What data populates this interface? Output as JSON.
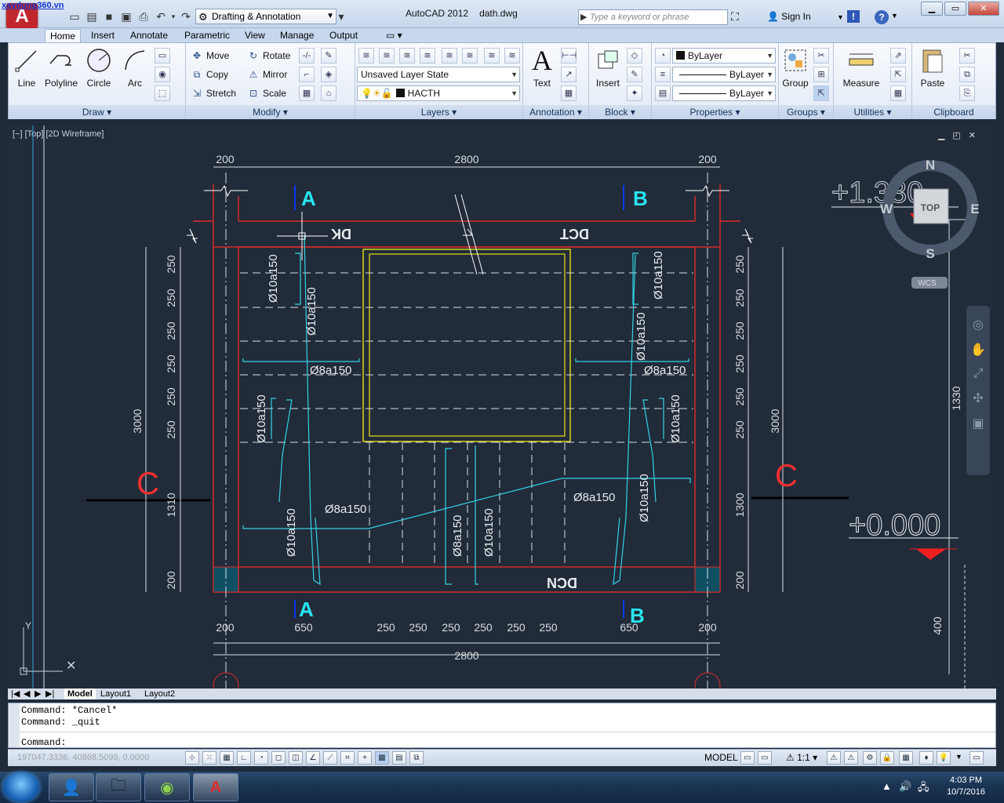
{
  "watermark": "xaydung360.vn",
  "app_logo": "A",
  "workspace": "Drafting & Annotation",
  "app_title": "AutoCAD 2012",
  "file_name": "dath.dwg",
  "search_placeholder": "Type a keyword or phrase",
  "sign_in": "Sign In",
  "tabs": [
    "Home",
    "Insert",
    "Annotate",
    "Parametric",
    "View",
    "Manage",
    "Output"
  ],
  "draw": {
    "line": "Line",
    "polyline": "Polyline",
    "circle": "Circle",
    "arc": "Arc",
    "title": "Draw"
  },
  "modify": {
    "move": "Move",
    "rotate": "Rotate",
    "copy": "Copy",
    "mirror": "Mirror",
    "stretch": "Stretch",
    "scale": "Scale",
    "title": "Modify"
  },
  "layers": {
    "state": "Unsaved Layer State",
    "current": "HACTH",
    "title": "Layers"
  },
  "annotation": {
    "text": "Text",
    "title": "Annotation"
  },
  "block": {
    "insert": "Insert",
    "title": "Block"
  },
  "properties": {
    "color": "ByLayer",
    "linetype": "ByLayer",
    "lineweight": "ByLayer",
    "title": "Properties"
  },
  "groups": {
    "group": "Group",
    "title": "Groups"
  },
  "utilities": {
    "measure": "Measure",
    "title": "Utilities"
  },
  "clipboard": {
    "paste": "Paste",
    "title": "Clipboard"
  },
  "viewport_label": "[−] [Top] [2D Wireframe]",
  "viewcube": {
    "n": "N",
    "s": "S",
    "e": "E",
    "w": "W",
    "top": "TOP",
    "wcs": "WCS"
  },
  "drawing": {
    "dims_top": [
      "200",
      "2800",
      "200"
    ],
    "dims_bottom": [
      "200",
      "650",
      "250",
      "250",
      "250",
      "250",
      "250",
      "250",
      "650",
      "200"
    ],
    "dim_bottom_total": "2800",
    "dims_left": [
      "250",
      "250",
      "250",
      "250",
      "250",
      "250",
      "1310",
      "200"
    ],
    "dims_right": [
      "250",
      "250",
      "250",
      "250",
      "250",
      "250",
      "1300",
      "200"
    ],
    "dim_left_total": "3000",
    "dim_right_total": "3000",
    "dim_far_right": [
      "1330",
      "400"
    ],
    "section_a": "A",
    "section_b": "B",
    "section_c": "C",
    "label_dk": "DK",
    "label_dct": "DCT",
    "label_dcn": "DCN",
    "rebar": [
      "Ø10a150",
      "Ø10a150",
      "Ø8a150",
      "Ø8a150",
      "Ø10a150",
      "Ø10a150",
      "Ø10a150",
      "Ø10a150",
      "Ø8a150",
      "Ø8a150",
      "Ø10a150",
      "Ø8a150",
      "Ø10a150",
      "Ø10a150"
    ],
    "level_top": "+1.330",
    "level_bottom": "+0.000"
  },
  "layout_tabs": [
    "Model",
    "Layout1",
    "Layout2"
  ],
  "command_history": [
    "Command: *Cancel*",
    "Command: _quit"
  ],
  "command_prompt": "Command:",
  "coordinates": "197047.3336, 40868.5099, 0.0000",
  "status_model": "MODEL",
  "annotation_scale": "1:1",
  "clock": {
    "time": "4:03 PM",
    "date": "10/7/2016"
  }
}
